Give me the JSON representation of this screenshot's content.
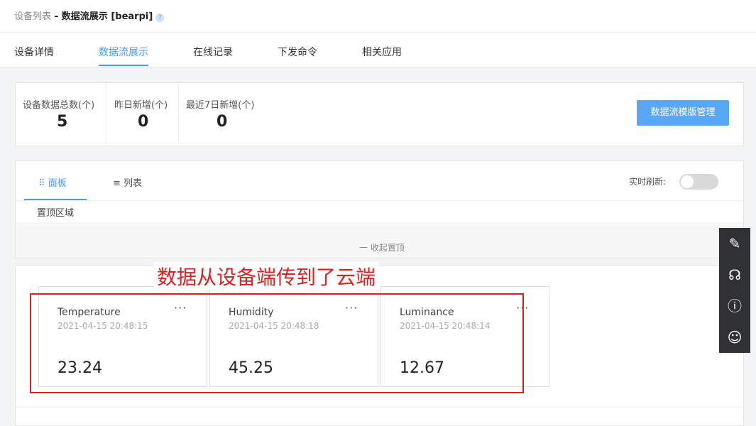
{
  "breadcrumb": {
    "parent": "设备列表",
    "sep": "–",
    "current": "数据流展示 [bearpi]",
    "help": "?"
  },
  "tabs": [
    "设备详情",
    "数据流展示",
    "在线记录",
    "下发命令",
    "相关应用"
  ],
  "stats": [
    {
      "label": "设备数据总数(个)",
      "value": "5"
    },
    {
      "label": "昨日新增(个)",
      "value": "0"
    },
    {
      "label": "最近7日新增(个)",
      "value": "0"
    }
  ],
  "manage_button": "数据流模版管理",
  "view": {
    "panel": "面板",
    "list": "列表",
    "refresh": "实时刷新:",
    "pinned": "置顶区域",
    "collapse": "一 收起置顶"
  },
  "annotation": "数据从设备端传到了云端",
  "datapoints": [
    {
      "name": "Temperature",
      "time": "2021-04-15 20:48:15",
      "value": "23.24"
    },
    {
      "name": "Humidity",
      "time": "2021-04-15 20:48:18",
      "value": "45.25"
    },
    {
      "name": "Luminance",
      "time": "2021-04-15 20:48:14",
      "value": "12.67"
    }
  ],
  "more": "···",
  "side_icons": [
    "edit-icon",
    "headset-icon",
    "help-icon",
    "users-icon"
  ],
  "colors": {
    "accent": "#409eff",
    "button": "#5aa7f6",
    "annotation": "#e02020"
  }
}
